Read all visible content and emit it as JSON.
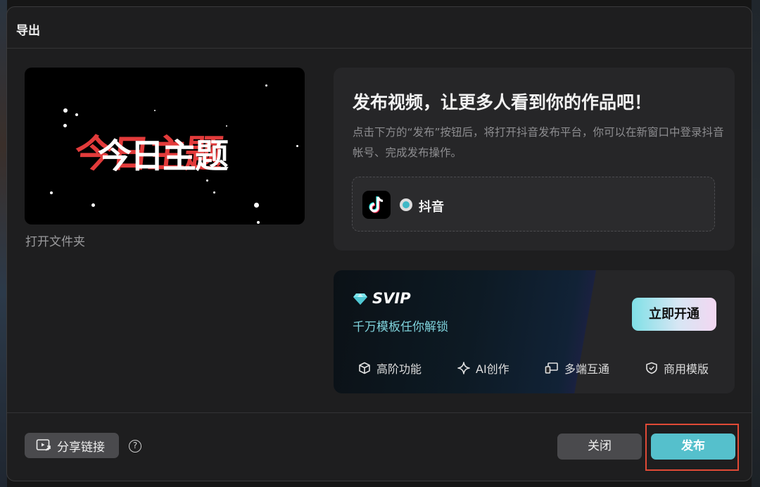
{
  "dialog": {
    "title": "导出",
    "open_folder": "打开文件夹",
    "preview": {
      "text": "今日主题"
    }
  },
  "publish": {
    "heading": "发布视频，让更多人看到你的作品吧！",
    "description": "点击下方的“发布”按钮后，将打开抖音发布平台，你可以在新窗口中登录抖音帐号、完成发布操作。",
    "platform": {
      "name": "抖音",
      "selected": true,
      "icon": "tiktok-icon"
    }
  },
  "svip": {
    "title": "SVIP",
    "subtitle": "千万模板任你解锁",
    "open_button": "立即开通",
    "features": [
      {
        "label": "高阶功能",
        "icon": "cube-icon"
      },
      {
        "label": "AI创作",
        "icon": "sparkle-icon"
      },
      {
        "label": "多端互通",
        "icon": "devices-icon"
      },
      {
        "label": "商用模版",
        "icon": "shield-check-icon"
      }
    ]
  },
  "footer": {
    "share_link": "分享链接",
    "help": "?",
    "close": "关闭",
    "publish": "发布"
  },
  "colors": {
    "accent": "#55c0cc",
    "highlight_box": "#e04a36",
    "theme_red": "#e23b3b"
  }
}
